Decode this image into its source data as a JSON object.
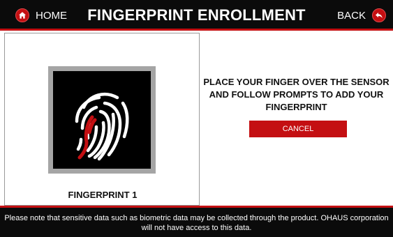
{
  "header": {
    "home_label": "HOME",
    "title": "FINGERPRINT ENROLLMENT",
    "back_label": "BACK",
    "home_icon": "home-icon",
    "back_icon": "back-arrow-icon"
  },
  "left_panel": {
    "fingerprint_icon": "fingerprint-icon",
    "label": "FINGERPRINT 1"
  },
  "right_panel": {
    "instruction_lines": [
      "PLACE YOUR FINGER OVER THE SENSOR",
      "AND FOLLOW PROMPTS TO ADD YOUR",
      "FINGERPRINT"
    ],
    "cancel_label": "CANCEL"
  },
  "footer": {
    "notice_lines": [
      "Please note that sensitive data such as biometric data may be collected through the product. OHAUS corporation",
      "will not have access to this data."
    ]
  },
  "colors": {
    "accent": "#c40f12",
    "bar_background": "#0b0b0b",
    "frame_gray": "#a5a5a5"
  }
}
